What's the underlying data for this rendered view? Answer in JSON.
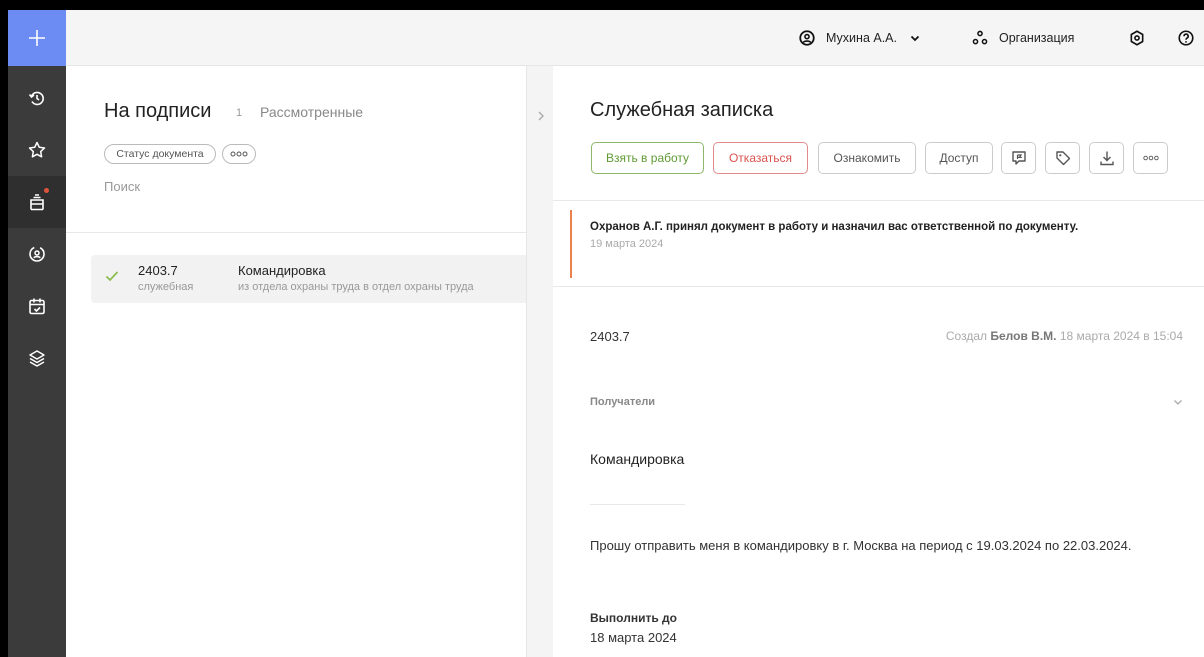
{
  "topbar": {
    "user_name": "Мухина А.А.",
    "org_label": "Организация"
  },
  "rail": {
    "items": [
      "add",
      "history",
      "favorites",
      "inbox",
      "tasks",
      "calendar",
      "layers"
    ],
    "accent_color": "#6d8cf3",
    "notification_color": "#e0533f"
  },
  "list": {
    "title": "На подписи",
    "count": "1",
    "tab_reviewed": "Рассмотренные",
    "filter_chip": "Статус документа",
    "more_chip": "ooo",
    "search_placeholder": "Поиск",
    "rows": [
      {
        "number": "2403.7",
        "type": "служебная",
        "title": "Командировка",
        "subtitle": "из отдела охраны труда в отдел охраны труда",
        "checked": true
      }
    ]
  },
  "doc": {
    "title": "Служебная записка",
    "actions": {
      "take": "Взять в работу",
      "refuse": "Отказаться",
      "acquaint": "Ознакомить",
      "access": "Доступ",
      "more": "ooo"
    },
    "notice": {
      "text": "Охранов А.Г. принял документ в работу и назначил вас ответственной по документу.",
      "date": "19 марта 2024"
    },
    "number": "2403.7",
    "created_prefix": "Создал",
    "created_author": "Белов В.М.",
    "created_when": "18 марта 2024 в 15:04",
    "recipients_label": "Получатели",
    "subject": "Командировка",
    "body": "Прошу отправить меня в командировку в г. Москва на период с 19.03.2024 по 22.03.2024.",
    "due_label": "Выполнить до",
    "due_date": "18 марта 2024"
  },
  "colors": {
    "take_button": "#5f9a34",
    "refuse_button": "#d9534f",
    "notice_accent": "#e9834b",
    "rail_bg": "#3b3b3b"
  }
}
